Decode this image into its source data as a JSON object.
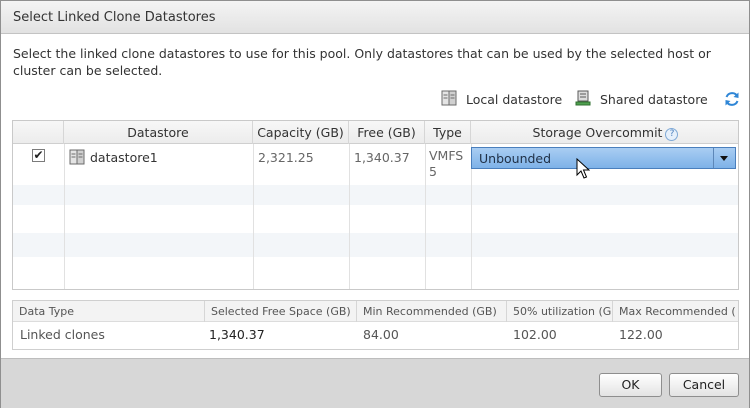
{
  "dialog": {
    "title": "Select Linked Clone Datastores",
    "description": "Select the linked clone datastores to use for this pool. Only datastores that can be used by the selected host or cluster can be selected."
  },
  "legend": {
    "local_label": "Local datastore",
    "shared_label": "Shared datastore",
    "refresh_icon": "refresh-icon"
  },
  "datastore_table": {
    "columns": [
      "Datastore",
      "Capacity (GB)",
      "Free (GB)",
      "Type",
      "Storage Overcommit"
    ],
    "rows": [
      {
        "checked": true,
        "checkbox_glyph": "✔",
        "datastore": "datastore1",
        "capacity": "2,321.25",
        "free": "1,340.37",
        "type_line1": "VMFS",
        "type_line2": "5",
        "overcommit": "Unbounded"
      }
    ],
    "help_glyph": "?"
  },
  "summary_table": {
    "columns": [
      "Data Type",
      "Selected Free Space (GB)",
      "Min Recommended (GB)",
      "50% utilization (G",
      "Max Recommended ("
    ],
    "rows": [
      {
        "data_type": "Linked clones",
        "selected_free": "1,340.37",
        "min_recommended": "84.00",
        "util_50": "102.00",
        "max_recommended": "122.00"
      }
    ]
  },
  "buttons": {
    "ok": "OK",
    "cancel": "Cancel"
  },
  "colors": {
    "selection_blue": "#7eb2e8",
    "footer_gray": "#d7d7d7",
    "accent": "#4a7fbd"
  }
}
